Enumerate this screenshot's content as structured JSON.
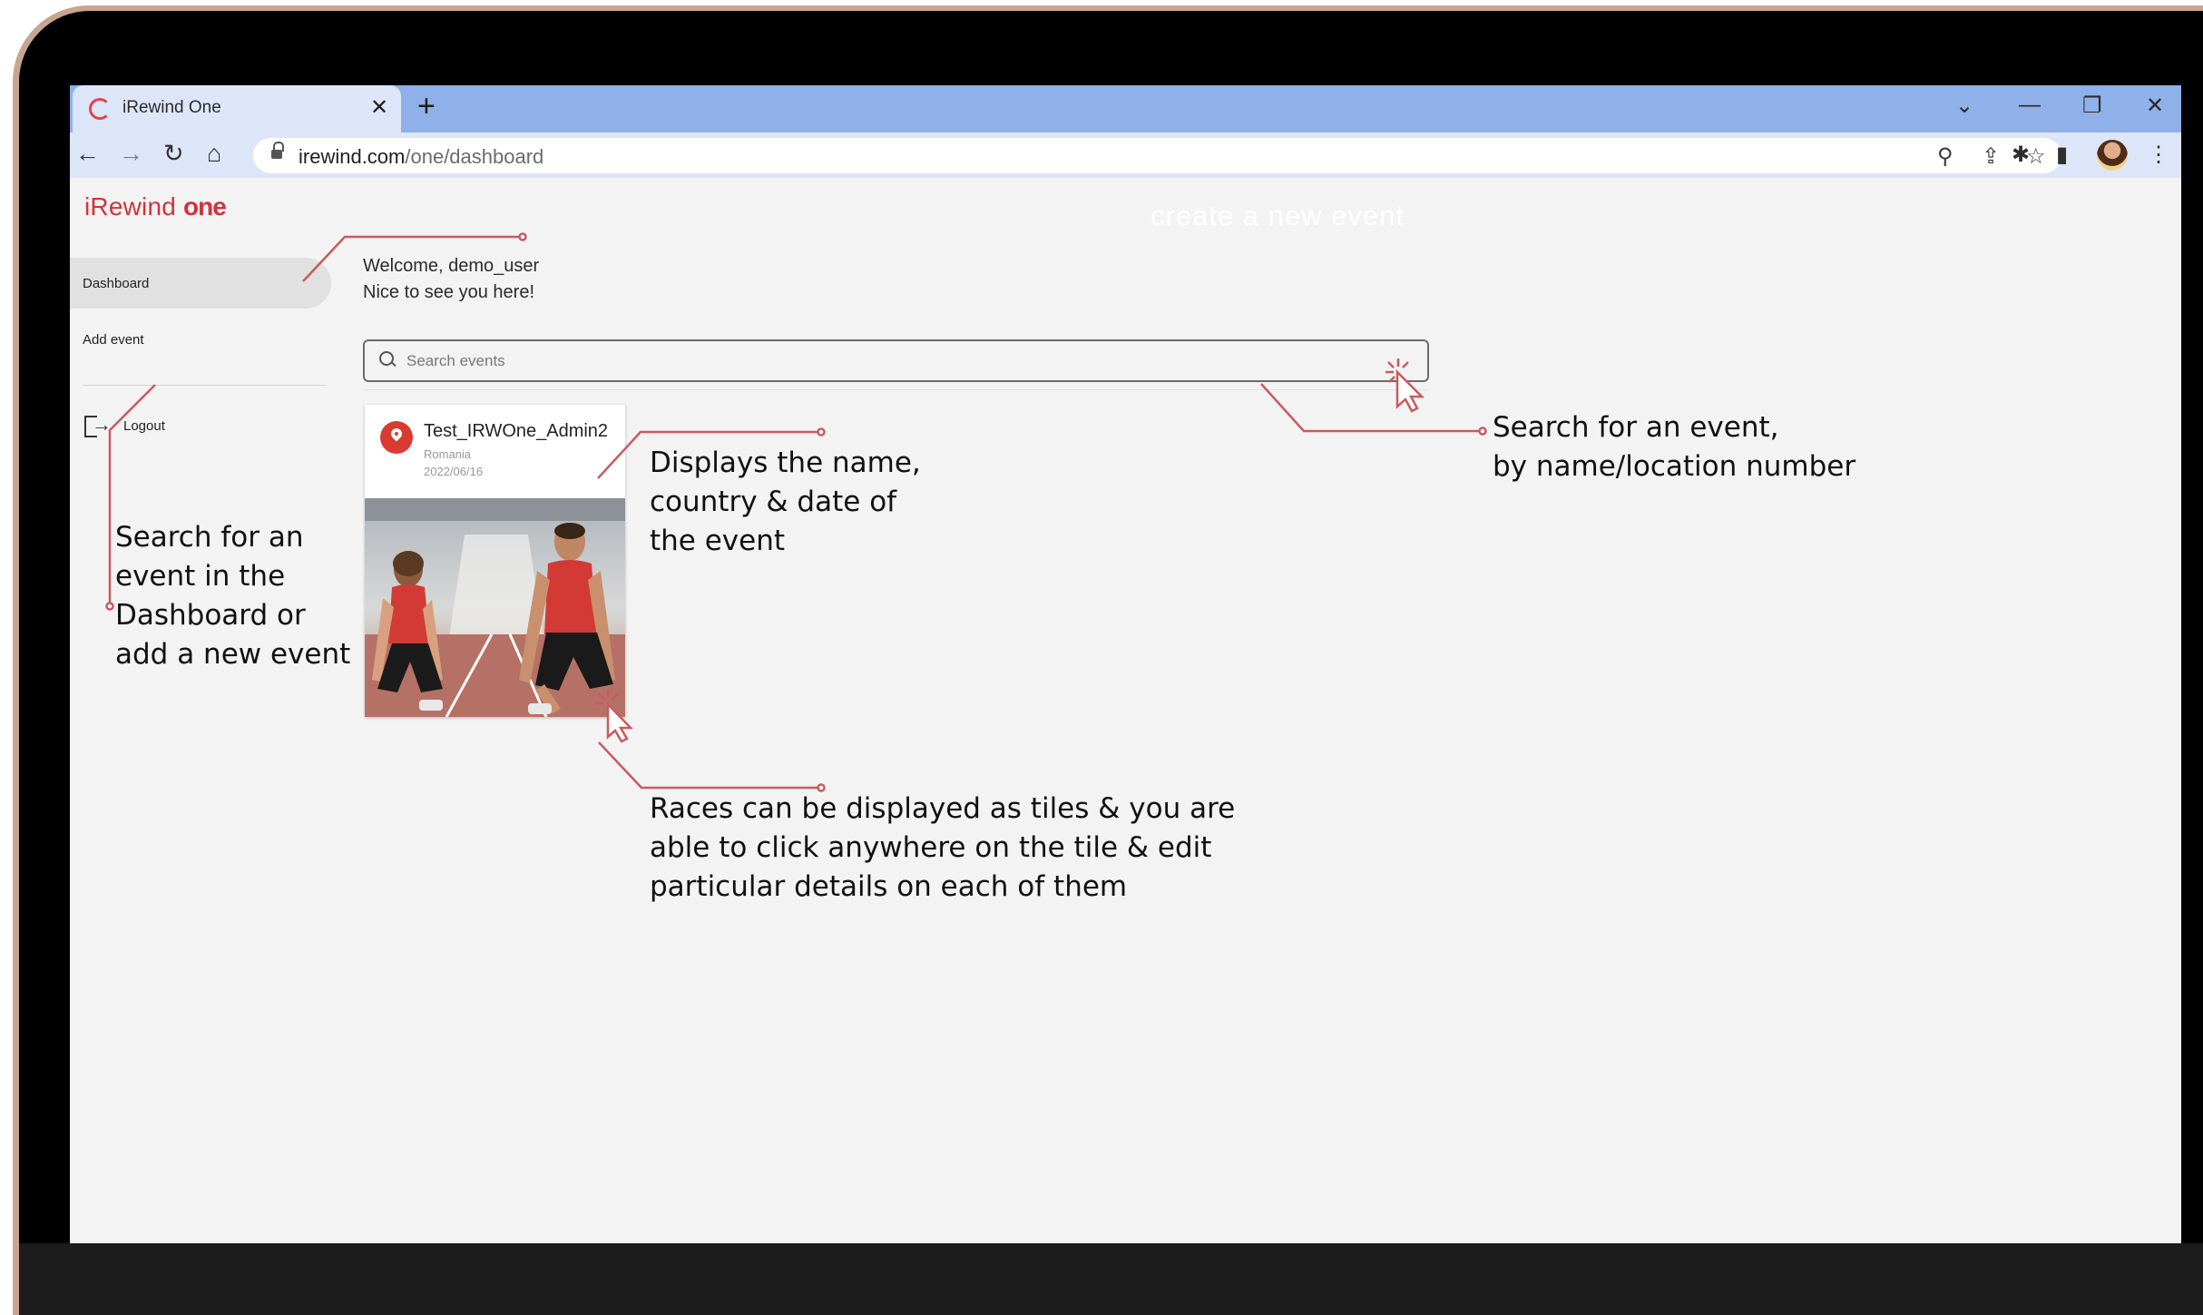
{
  "browser": {
    "tab_title": "iRewind One",
    "tab_close": "✕",
    "new_tab": "+",
    "url_host": "irewind.com",
    "url_path": "/one/dashboard",
    "window_controls": {
      "tabs_menu": "⌄",
      "minimize": "—",
      "restore": "❐",
      "close": "✕"
    },
    "nav": {
      "back": "←",
      "forward": "→",
      "reload": "↻",
      "home": "⌂"
    },
    "omnibox_icons": {
      "zoom": "⚲",
      "share": "⇪",
      "bookmark": "☆"
    },
    "toolbar_icons": {
      "extensions": "✱",
      "side_panel": "▮",
      "menu": "⋮"
    }
  },
  "app": {
    "logo_main": "iRewind ",
    "logo_accent": "one",
    "header_ghost_text": "create a new event",
    "brand_color": "#d2323a"
  },
  "sidebar": {
    "items": [
      {
        "label": "Dashboard",
        "active": true
      },
      {
        "label": "Add event",
        "active": false
      }
    ],
    "logout_label": "Logout"
  },
  "main": {
    "welcome_line1": "Welcome, demo_user",
    "welcome_line2": "Nice to see you here!",
    "search": {
      "placeholder": "Search events",
      "value": ""
    },
    "events": [
      {
        "name": "Test_IRWOne_Admin2",
        "country": "Romania",
        "date": "2022/06/16",
        "image": "sprint-start-photo"
      }
    ]
  },
  "annotations": {
    "sidebar_note": "Search for an\nevent in the\nDashboard or\nadd a new event",
    "tile_info_note": "Displays the name,\ncountry & date of\nthe event",
    "search_note": "Search for an event,\nby name/location number",
    "tile_click_note": "Races can be displayed as tiles & you are\nable to click anywhere on the tile & edit\nparticular details on each of them",
    "line_color": "#c95a5f"
  }
}
